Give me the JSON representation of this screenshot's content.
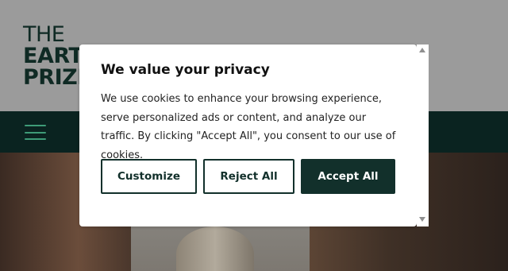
{
  "site": {
    "logo": {
      "line1": "THE",
      "line2": "EARTH",
      "line3": "PRIZE"
    }
  },
  "nav": {
    "menu_icon": "hamburger-menu-icon"
  },
  "consent": {
    "title": "We value your privacy",
    "body": "We use cookies to enhance your browsing experience, serve personalized ads or content, and analyze our traffic. By clicking \"Accept All\", you consent to our use of cookies.",
    "buttons": {
      "customize": "Customize",
      "reject": "Reject All",
      "accept": "Accept All"
    }
  },
  "colors": {
    "brand_dark": "#12302b",
    "nav_background": "#0a2320",
    "hamburger": "#3e9b78",
    "overlay": "#9b9b9b"
  }
}
